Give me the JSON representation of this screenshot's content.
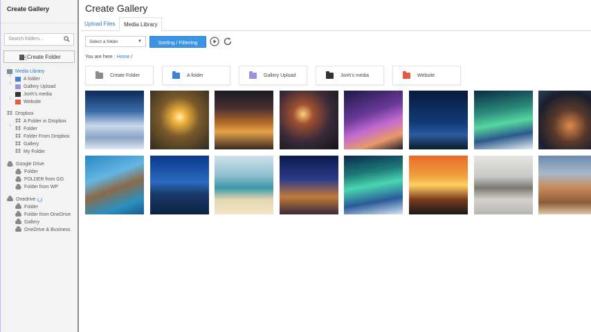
{
  "sidebar": {
    "title": "Create Gallery",
    "search_placeholder": "Search folders...",
    "create_folder_label": "Create Folder",
    "tree": [
      {
        "label": "Media Library",
        "icon": "folder-icon",
        "color": "#7d8ea0",
        "active": true
      },
      {
        "label": "A folder",
        "icon": "folder-icon",
        "color": "#3b82d8"
      },
      {
        "label": "Gallery Upload",
        "icon": "folder-icon",
        "color": "#9a8fe0"
      },
      {
        "label": "Jonh's media",
        "icon": "folder-icon",
        "color": "#333333"
      },
      {
        "label": "Website",
        "icon": "folder-icon",
        "color": "#e35b3c"
      },
      {
        "label": "Dropbox",
        "icon": "dropbox-icon"
      },
      {
        "label": "A Folder in Dropbox",
        "icon": "dropbox-icon"
      },
      {
        "label": "Folder",
        "icon": "dropbox-icon"
      },
      {
        "label": "Folder From Dropbox",
        "icon": "dropbox-icon"
      },
      {
        "label": "Gallery",
        "icon": "dropbox-icon"
      },
      {
        "label": "My Folder",
        "icon": "dropbox-icon"
      },
      {
        "label": "Google Drive",
        "icon": "google-drive-icon"
      },
      {
        "label": "Folder",
        "icon": "google-drive-icon"
      },
      {
        "label": "FOLDER from GG",
        "icon": "google-drive-icon"
      },
      {
        "label": "Folder from WP",
        "icon": "google-drive-icon"
      },
      {
        "label": "Onedrive",
        "icon": "onedrive-icon"
      },
      {
        "label": "Folder",
        "icon": "onedrive-icon"
      },
      {
        "label": "Folder from OneDrive",
        "icon": "onedrive-icon"
      },
      {
        "label": "Gallery",
        "icon": "onedrive-icon"
      },
      {
        "label": "OneDrive & Business",
        "icon": "onedrive-icon"
      }
    ]
  },
  "main": {
    "title": "Create Gallery",
    "tabs": [
      {
        "label": "Upload Files",
        "active": false
      },
      {
        "label": "Media Library",
        "active": true
      }
    ],
    "folder_select": "Select a folder",
    "sort_button": "Sorting / Filtering",
    "breadcrumb": {
      "prefix": "You are here :",
      "home": "Home",
      "sep": "/"
    },
    "folders": [
      {
        "label": "Create Folder",
        "color": "#8a8a8a"
      },
      {
        "label": "A folder",
        "color": "#3b82d8"
      },
      {
        "label": "Gallery Upload",
        "color": "#9a8fe0"
      },
      {
        "label": "Jonh's media",
        "color": "#333333"
      },
      {
        "label": "Website",
        "color": "#e35b3c"
      }
    ]
  },
  "colors": {
    "accent": "#2a7ac8",
    "button": "#3b93e6"
  }
}
